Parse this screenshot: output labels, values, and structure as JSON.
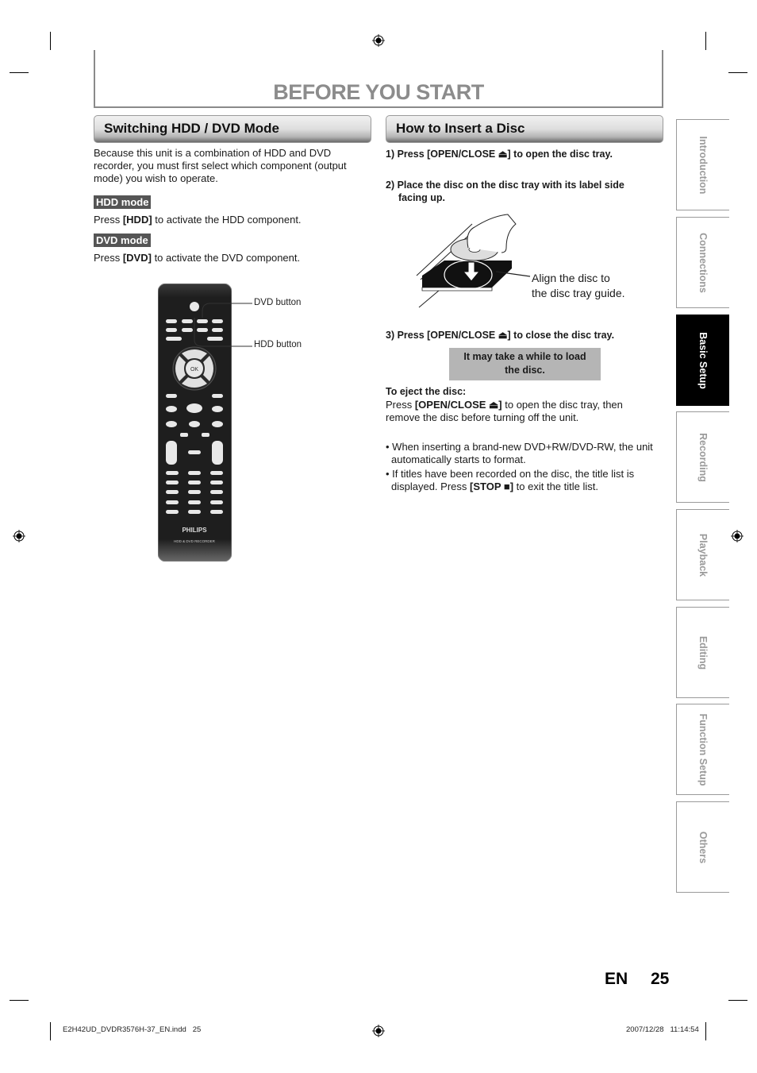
{
  "page": {
    "title": "BEFORE YOU START",
    "language": "EN",
    "number": "25"
  },
  "left_section": {
    "heading": "Switching HDD / DVD Mode",
    "intro": "Because this unit is a combination of HDD and DVD recorder, you must first select which component (output mode) you wish to operate.",
    "hdd_mode": {
      "tag": "HDD mode",
      "prefix": "Press ",
      "key": "[HDD]",
      "suffix": " to activate the HDD component."
    },
    "dvd_mode": {
      "tag": "DVD mode",
      "prefix": "Press ",
      "key": "[DVD]",
      "suffix": " to activate the DVD component."
    },
    "remote": {
      "brand": "PHILIPS",
      "model": "HDD & DVD RECORDER",
      "callouts": [
        "DVD button",
        "HDD button"
      ],
      "ok_label": "OK"
    }
  },
  "right_section": {
    "heading": "How to Insert a Disc",
    "steps": [
      "1) Press [OPEN/CLOSE ⏏] to open the disc tray.",
      "2) Place the disc on the disc tray with its label side",
      "facing up.",
      "3) Press [OPEN/CLOSE ⏏] to close the disc tray."
    ],
    "illustration_caption": [
      "Align the disc to",
      "the disc tray guide."
    ],
    "note": [
      "It may take a while to load",
      "the disc."
    ],
    "eject": {
      "heading": "To eject the disc:",
      "line1_prefix": "Press ",
      "line1_key": "[OPEN/CLOSE ⏏]",
      "line1_suffix": " to open the disc tray, then",
      "line2": "remove the disc before turning off the unit."
    },
    "bullets": [
      {
        "line1": "When inserting a brand-new DVD+RW/DVD-RW, the unit",
        "line2": "automatically starts to format."
      },
      {
        "line1": "If titles have been recorded on the disc, the title list is",
        "line2_prefix": "displayed. Press ",
        "line2_key": "[STOP ■]",
        "line2_suffix": " to exit the title list."
      }
    ]
  },
  "side_tabs": [
    {
      "label": "Introduction",
      "active": false
    },
    {
      "label": "Connections",
      "active": false
    },
    {
      "label": "Basic Setup",
      "active": true
    },
    {
      "label": "Recording",
      "active": false
    },
    {
      "label": "Playback",
      "active": false
    },
    {
      "label": "Editing",
      "active": false
    },
    {
      "label": "Function Setup",
      "active": false
    },
    {
      "label": "Others",
      "active": false
    }
  ],
  "footer": {
    "file": "E2H42UD_DVDR3576H-37_EN.indd   25",
    "timestamp": "2007/12/28   11:14:54"
  }
}
